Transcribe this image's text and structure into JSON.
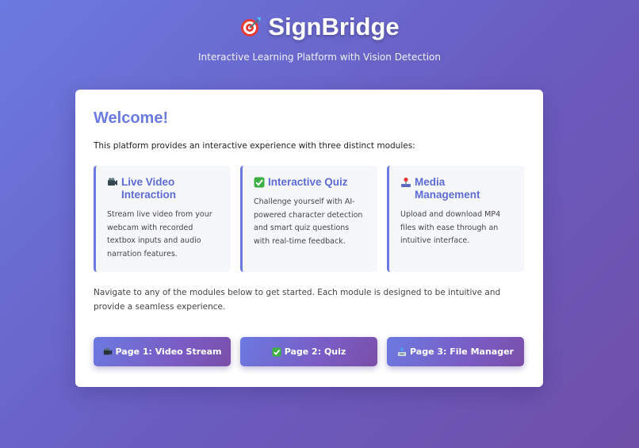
{
  "header": {
    "title": "SignBridge",
    "subtitle": "Interactive Learning Platform with Vision Detection",
    "title_icon": "target-dart-icon"
  },
  "main": {
    "welcome_heading": "Welcome!",
    "intro": "This platform provides an interactive experience with three distinct modules:",
    "modules": [
      {
        "icon": "video-camera-icon",
        "title": "Live Video Interaction",
        "description": "Stream live video from your webcam with recorded textbox inputs and audio narration features."
      },
      {
        "icon": "check-mark-icon",
        "title": "Interactive Quiz",
        "description": "Challenge yourself with AI-powered character detection and smart quiz questions with real-time feedback."
      },
      {
        "icon": "joystick-icon",
        "title": "Media Management",
        "description": "Upload and download MP4 files with ease through an intuitive interface."
      }
    ],
    "navigation_text": "Navigate to any of the modules below to get started. Each module is designed to be intuitive and provide a seamless experience.",
    "buttons": [
      {
        "icon": "video-camera-icon",
        "label": "Page 1: Video Stream"
      },
      {
        "icon": "check-mark-icon",
        "label": "Page 2: Quiz"
      },
      {
        "icon": "inbox-tray-icon",
        "label": "Page 3: File Manager"
      }
    ]
  },
  "colors": {
    "accent": "#6b7ae0",
    "background_start": "#6b7ae0",
    "background_end": "#6f4fa8",
    "card": "#ffffff",
    "module_bg": "#f6f7fb",
    "check_green": "#3cb043"
  }
}
